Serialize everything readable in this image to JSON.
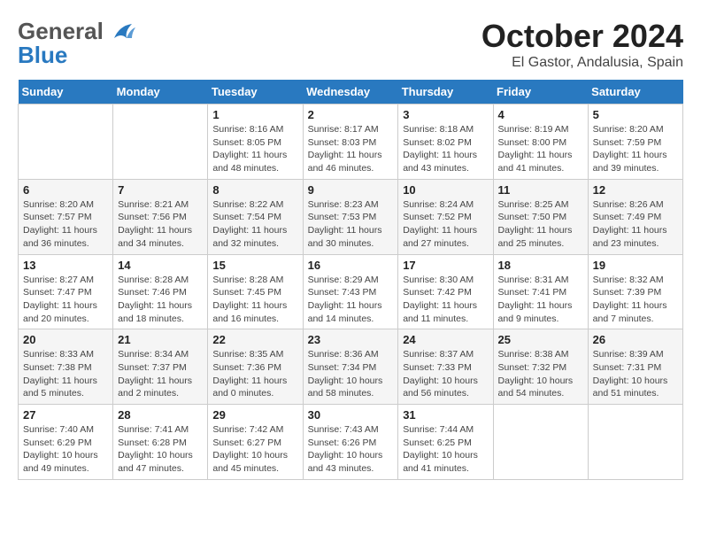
{
  "header": {
    "logo_general": "General",
    "logo_blue": "Blue",
    "month": "October 2024",
    "location": "El Gastor, Andalusia, Spain"
  },
  "days_of_week": [
    "Sunday",
    "Monday",
    "Tuesday",
    "Wednesday",
    "Thursday",
    "Friday",
    "Saturday"
  ],
  "weeks": [
    [
      {
        "day": "",
        "info": ""
      },
      {
        "day": "",
        "info": ""
      },
      {
        "day": "1",
        "info": "Sunrise: 8:16 AM\nSunset: 8:05 PM\nDaylight: 11 hours and 48 minutes."
      },
      {
        "day": "2",
        "info": "Sunrise: 8:17 AM\nSunset: 8:03 PM\nDaylight: 11 hours and 46 minutes."
      },
      {
        "day": "3",
        "info": "Sunrise: 8:18 AM\nSunset: 8:02 PM\nDaylight: 11 hours and 43 minutes."
      },
      {
        "day": "4",
        "info": "Sunrise: 8:19 AM\nSunset: 8:00 PM\nDaylight: 11 hours and 41 minutes."
      },
      {
        "day": "5",
        "info": "Sunrise: 8:20 AM\nSunset: 7:59 PM\nDaylight: 11 hours and 39 minutes."
      }
    ],
    [
      {
        "day": "6",
        "info": "Sunrise: 8:20 AM\nSunset: 7:57 PM\nDaylight: 11 hours and 36 minutes."
      },
      {
        "day": "7",
        "info": "Sunrise: 8:21 AM\nSunset: 7:56 PM\nDaylight: 11 hours and 34 minutes."
      },
      {
        "day": "8",
        "info": "Sunrise: 8:22 AM\nSunset: 7:54 PM\nDaylight: 11 hours and 32 minutes."
      },
      {
        "day": "9",
        "info": "Sunrise: 8:23 AM\nSunset: 7:53 PM\nDaylight: 11 hours and 30 minutes."
      },
      {
        "day": "10",
        "info": "Sunrise: 8:24 AM\nSunset: 7:52 PM\nDaylight: 11 hours and 27 minutes."
      },
      {
        "day": "11",
        "info": "Sunrise: 8:25 AM\nSunset: 7:50 PM\nDaylight: 11 hours and 25 minutes."
      },
      {
        "day": "12",
        "info": "Sunrise: 8:26 AM\nSunset: 7:49 PM\nDaylight: 11 hours and 23 minutes."
      }
    ],
    [
      {
        "day": "13",
        "info": "Sunrise: 8:27 AM\nSunset: 7:47 PM\nDaylight: 11 hours and 20 minutes."
      },
      {
        "day": "14",
        "info": "Sunrise: 8:28 AM\nSunset: 7:46 PM\nDaylight: 11 hours and 18 minutes."
      },
      {
        "day": "15",
        "info": "Sunrise: 8:28 AM\nSunset: 7:45 PM\nDaylight: 11 hours and 16 minutes."
      },
      {
        "day": "16",
        "info": "Sunrise: 8:29 AM\nSunset: 7:43 PM\nDaylight: 11 hours and 14 minutes."
      },
      {
        "day": "17",
        "info": "Sunrise: 8:30 AM\nSunset: 7:42 PM\nDaylight: 11 hours and 11 minutes."
      },
      {
        "day": "18",
        "info": "Sunrise: 8:31 AM\nSunset: 7:41 PM\nDaylight: 11 hours and 9 minutes."
      },
      {
        "day": "19",
        "info": "Sunrise: 8:32 AM\nSunset: 7:39 PM\nDaylight: 11 hours and 7 minutes."
      }
    ],
    [
      {
        "day": "20",
        "info": "Sunrise: 8:33 AM\nSunset: 7:38 PM\nDaylight: 11 hours and 5 minutes."
      },
      {
        "day": "21",
        "info": "Sunrise: 8:34 AM\nSunset: 7:37 PM\nDaylight: 11 hours and 2 minutes."
      },
      {
        "day": "22",
        "info": "Sunrise: 8:35 AM\nSunset: 7:36 PM\nDaylight: 11 hours and 0 minutes."
      },
      {
        "day": "23",
        "info": "Sunrise: 8:36 AM\nSunset: 7:34 PM\nDaylight: 10 hours and 58 minutes."
      },
      {
        "day": "24",
        "info": "Sunrise: 8:37 AM\nSunset: 7:33 PM\nDaylight: 10 hours and 56 minutes."
      },
      {
        "day": "25",
        "info": "Sunrise: 8:38 AM\nSunset: 7:32 PM\nDaylight: 10 hours and 54 minutes."
      },
      {
        "day": "26",
        "info": "Sunrise: 8:39 AM\nSunset: 7:31 PM\nDaylight: 10 hours and 51 minutes."
      }
    ],
    [
      {
        "day": "27",
        "info": "Sunrise: 7:40 AM\nSunset: 6:29 PM\nDaylight: 10 hours and 49 minutes."
      },
      {
        "day": "28",
        "info": "Sunrise: 7:41 AM\nSunset: 6:28 PM\nDaylight: 10 hours and 47 minutes."
      },
      {
        "day": "29",
        "info": "Sunrise: 7:42 AM\nSunset: 6:27 PM\nDaylight: 10 hours and 45 minutes."
      },
      {
        "day": "30",
        "info": "Sunrise: 7:43 AM\nSunset: 6:26 PM\nDaylight: 10 hours and 43 minutes."
      },
      {
        "day": "31",
        "info": "Sunrise: 7:44 AM\nSunset: 6:25 PM\nDaylight: 10 hours and 41 minutes."
      },
      {
        "day": "",
        "info": ""
      },
      {
        "day": "",
        "info": ""
      }
    ]
  ]
}
